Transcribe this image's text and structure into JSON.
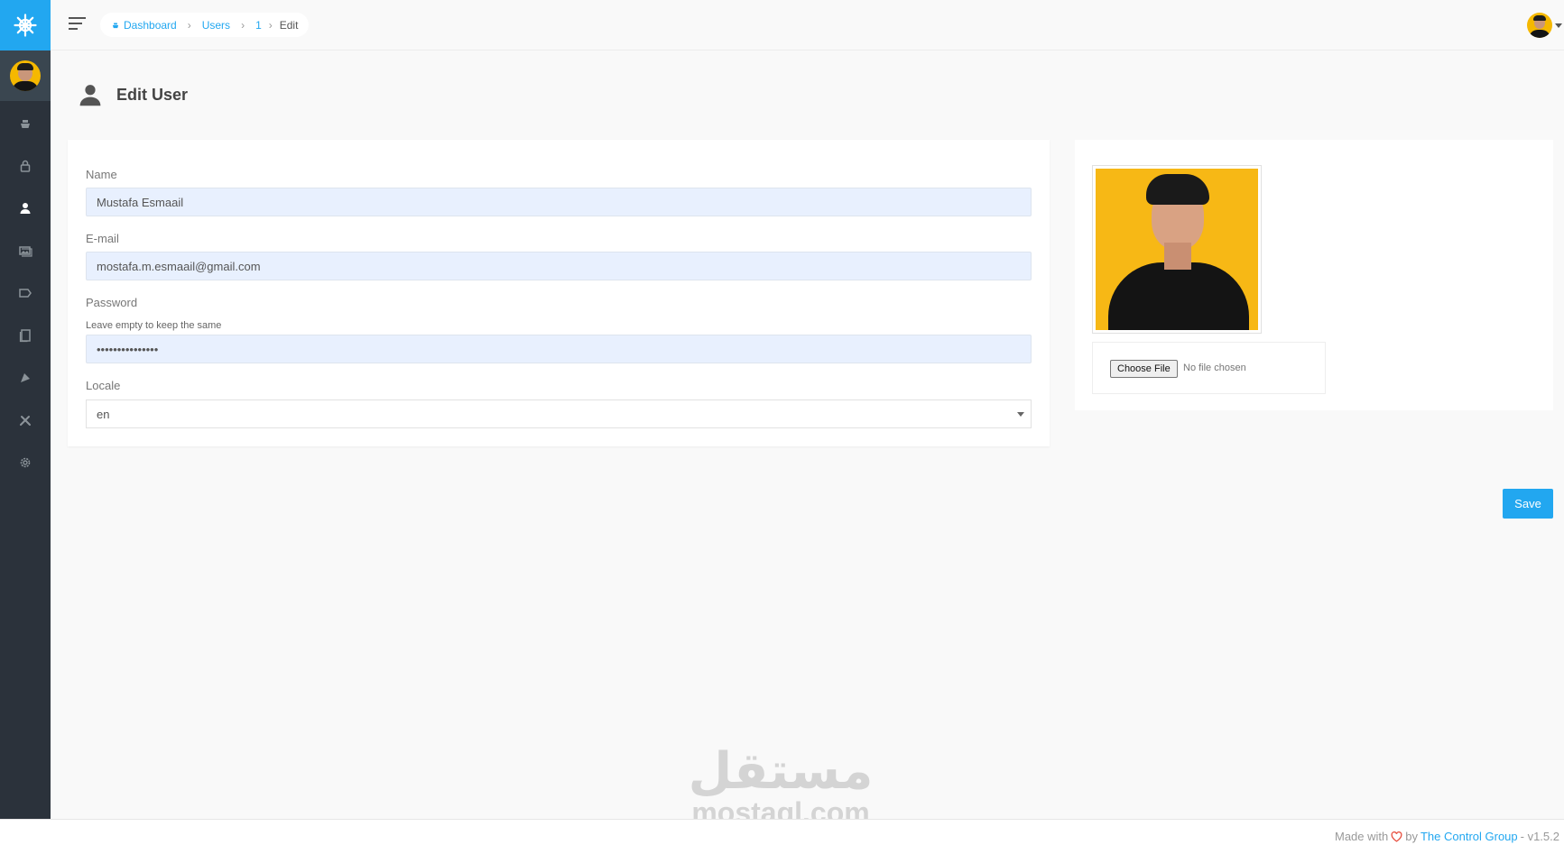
{
  "sidebar": {
    "brand_icon": "helm-icon",
    "items": [
      {
        "name": "dashboard",
        "icon": "boat-icon"
      },
      {
        "name": "roles",
        "icon": "lock-icon"
      },
      {
        "name": "users",
        "icon": "person-icon",
        "active": true
      },
      {
        "name": "media",
        "icon": "images-icon"
      },
      {
        "name": "categories",
        "icon": "tag-icon"
      },
      {
        "name": "pages",
        "icon": "documents-icon"
      },
      {
        "name": "compass",
        "icon": "compass-icon"
      },
      {
        "name": "tools",
        "icon": "tools-icon"
      },
      {
        "name": "settings",
        "icon": "gear-icon"
      }
    ]
  },
  "breadcrumb": {
    "dashboard": "Dashboard",
    "users": "Users",
    "id": "1",
    "current": "Edit"
  },
  "page": {
    "title": "Edit User"
  },
  "form": {
    "name_label": "Name",
    "name_value": "Mustafa Esmaail",
    "email_label": "E-mail",
    "email_value": "mostafa.m.esmaail@gmail.com",
    "password_label": "Password",
    "password_hint": "Leave empty to keep the same",
    "password_value": "•••••••••••••••",
    "locale_label": "Locale",
    "locale_value": "en"
  },
  "avatar_upload": {
    "choose_label": "Choose File",
    "status": "No file chosen"
  },
  "actions": {
    "save_label": "Save"
  },
  "watermark": {
    "arabic": "مستقل",
    "latin": "mostaql.com"
  },
  "footer": {
    "made_with": "Made with",
    "by": "by",
    "company": "The Control Group",
    "version": "- v1.5.2"
  },
  "colors": {
    "accent": "#22a7f0",
    "sidebar": "#2b323b",
    "photo_bg": "#f7b815"
  }
}
